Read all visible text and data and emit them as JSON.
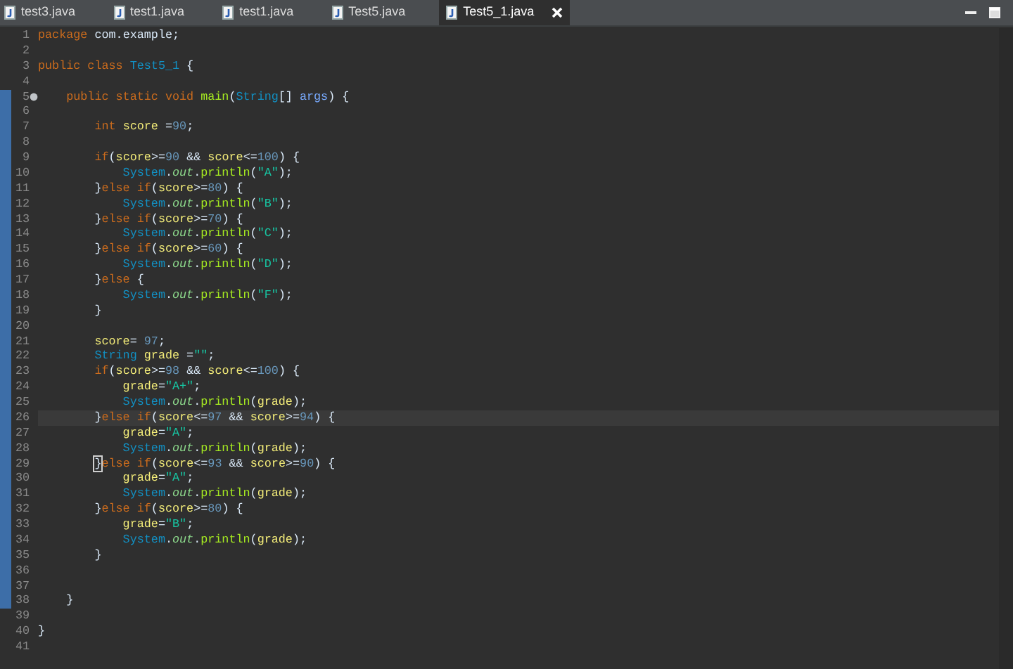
{
  "tabs": [
    {
      "label": "test3.java",
      "selected": false
    },
    {
      "label": "test1.java",
      "selected": false
    },
    {
      "label": "test1.java",
      "selected": false
    },
    {
      "label": "Test5.java",
      "selected": false
    },
    {
      "label": "Test5_1.java",
      "selected": true
    }
  ],
  "editor": {
    "lines": [
      {
        "number": "1",
        "current": false,
        "in_range": false,
        "marker": false,
        "tokens": [
          {
            "text": "package ",
            "kind": "keyword"
          },
          {
            "text": "com.example;",
            "kind": "plain"
          }
        ]
      },
      {
        "number": "2",
        "current": false,
        "in_range": false,
        "marker": false
      },
      {
        "number": "3",
        "current": false,
        "in_range": false,
        "marker": false,
        "tokens": [
          {
            "text": "public class ",
            "kind": "keyword"
          },
          {
            "text": "Test5_1",
            "kind": "type"
          },
          {
            "text": " {",
            "kind": "plain"
          }
        ]
      },
      {
        "number": "4",
        "current": false,
        "in_range": false,
        "marker": false
      },
      {
        "number": "5",
        "current": false,
        "in_range": true,
        "marker": true,
        "tokens": [
          {
            "text": "    public static void ",
            "kind": "keyword"
          },
          {
            "text": "main",
            "kind": "method"
          },
          {
            "text": "(",
            "kind": "plain"
          },
          {
            "text": "String",
            "kind": "type"
          },
          {
            "text": "[] ",
            "kind": "plain"
          },
          {
            "text": "args",
            "kind": "param"
          },
          {
            "text": ") {",
            "kind": "plain"
          }
        ]
      },
      {
        "number": "6",
        "current": false,
        "in_range": true,
        "marker": false
      },
      {
        "number": "7",
        "current": false,
        "in_range": true,
        "marker": false,
        "tokens": [
          {
            "text": "        int ",
            "kind": "keyword"
          },
          {
            "text": "score",
            "kind": "local"
          },
          {
            "text": " =",
            "kind": "plain"
          },
          {
            "text": "90",
            "kind": "number"
          },
          {
            "text": ";",
            "kind": "plain"
          }
        ]
      },
      {
        "number": "8",
        "current": false,
        "in_range": true,
        "marker": false
      },
      {
        "number": "9",
        "current": false,
        "in_range": true,
        "marker": false,
        "tokens": [
          {
            "text": "        if",
            "kind": "keyword"
          },
          {
            "text": "(",
            "kind": "plain"
          },
          {
            "text": "score",
            "kind": "local"
          },
          {
            "text": ">=",
            "kind": "plain"
          },
          {
            "text": "90",
            "kind": "number"
          },
          {
            "text": " && ",
            "kind": "plain"
          },
          {
            "text": "score",
            "kind": "local"
          },
          {
            "text": "<=",
            "kind": "plain"
          },
          {
            "text": "100",
            "kind": "number"
          },
          {
            "text": ") {",
            "kind": "plain"
          }
        ]
      },
      {
        "number": "10",
        "current": false,
        "in_range": true,
        "marker": false,
        "tokens": [
          {
            "text": "            System",
            "kind": "type"
          },
          {
            "text": ".",
            "kind": "plain"
          },
          {
            "text": "out",
            "kind": "field"
          },
          {
            "text": ".",
            "kind": "plain"
          },
          {
            "text": "println",
            "kind": "method"
          },
          {
            "text": "(",
            "kind": "plain"
          },
          {
            "text": "\"A\"",
            "kind": "string"
          },
          {
            "text": ");",
            "kind": "plain"
          }
        ]
      },
      {
        "number": "11",
        "current": false,
        "in_range": true,
        "marker": false,
        "tokens": [
          {
            "text": "        }",
            "kind": "plain"
          },
          {
            "text": "else if",
            "kind": "keyword"
          },
          {
            "text": "(",
            "kind": "plain"
          },
          {
            "text": "score",
            "kind": "local"
          },
          {
            "text": ">=",
            "kind": "plain"
          },
          {
            "text": "80",
            "kind": "number"
          },
          {
            "text": ") {",
            "kind": "plain"
          }
        ]
      },
      {
        "number": "12",
        "current": false,
        "in_range": true,
        "marker": false,
        "tokens": [
          {
            "text": "            System",
            "kind": "type"
          },
          {
            "text": ".",
            "kind": "plain"
          },
          {
            "text": "out",
            "kind": "field"
          },
          {
            "text": ".",
            "kind": "plain"
          },
          {
            "text": "println",
            "kind": "method"
          },
          {
            "text": "(",
            "kind": "plain"
          },
          {
            "text": "\"B\"",
            "kind": "string"
          },
          {
            "text": ");",
            "kind": "plain"
          }
        ]
      },
      {
        "number": "13",
        "current": false,
        "in_range": true,
        "marker": false,
        "tokens": [
          {
            "text": "        }",
            "kind": "plain"
          },
          {
            "text": "else if",
            "kind": "keyword"
          },
          {
            "text": "(",
            "kind": "plain"
          },
          {
            "text": "score",
            "kind": "local"
          },
          {
            "text": ">=",
            "kind": "plain"
          },
          {
            "text": "70",
            "kind": "number"
          },
          {
            "text": ") {",
            "kind": "plain"
          }
        ]
      },
      {
        "number": "14",
        "current": false,
        "in_range": true,
        "marker": false,
        "tokens": [
          {
            "text": "            System",
            "kind": "type"
          },
          {
            "text": ".",
            "kind": "plain"
          },
          {
            "text": "out",
            "kind": "field"
          },
          {
            "text": ".",
            "kind": "plain"
          },
          {
            "text": "println",
            "kind": "method"
          },
          {
            "text": "(",
            "kind": "plain"
          },
          {
            "text": "\"C\"",
            "kind": "string"
          },
          {
            "text": ");",
            "kind": "plain"
          }
        ]
      },
      {
        "number": "15",
        "current": false,
        "in_range": true,
        "marker": false,
        "tokens": [
          {
            "text": "        }",
            "kind": "plain"
          },
          {
            "text": "else if",
            "kind": "keyword"
          },
          {
            "text": "(",
            "kind": "plain"
          },
          {
            "text": "score",
            "kind": "local"
          },
          {
            "text": ">=",
            "kind": "plain"
          },
          {
            "text": "60",
            "kind": "number"
          },
          {
            "text": ") {",
            "kind": "plain"
          }
        ]
      },
      {
        "number": "16",
        "current": false,
        "in_range": true,
        "marker": false,
        "tokens": [
          {
            "text": "            System",
            "kind": "type"
          },
          {
            "text": ".",
            "kind": "plain"
          },
          {
            "text": "out",
            "kind": "field"
          },
          {
            "text": ".",
            "kind": "plain"
          },
          {
            "text": "println",
            "kind": "method"
          },
          {
            "text": "(",
            "kind": "plain"
          },
          {
            "text": "\"D\"",
            "kind": "string"
          },
          {
            "text": ");",
            "kind": "plain"
          }
        ]
      },
      {
        "number": "17",
        "current": false,
        "in_range": true,
        "marker": false,
        "tokens": [
          {
            "text": "        }",
            "kind": "plain"
          },
          {
            "text": "else",
            "kind": "keyword"
          },
          {
            "text": " {",
            "kind": "plain"
          }
        ]
      },
      {
        "number": "18",
        "current": false,
        "in_range": true,
        "marker": false,
        "tokens": [
          {
            "text": "            System",
            "kind": "type"
          },
          {
            "text": ".",
            "kind": "plain"
          },
          {
            "text": "out",
            "kind": "field"
          },
          {
            "text": ".",
            "kind": "plain"
          },
          {
            "text": "println",
            "kind": "method"
          },
          {
            "text": "(",
            "kind": "plain"
          },
          {
            "text": "\"F\"",
            "kind": "string"
          },
          {
            "text": ");",
            "kind": "plain"
          }
        ]
      },
      {
        "number": "19",
        "current": false,
        "in_range": true,
        "marker": false,
        "tokens": [
          {
            "text": "        }",
            "kind": "plain"
          }
        ]
      },
      {
        "number": "20",
        "current": false,
        "in_range": true,
        "marker": false
      },
      {
        "number": "21",
        "current": false,
        "in_range": true,
        "marker": false,
        "tokens": [
          {
            "text": "        score",
            "kind": "local"
          },
          {
            "text": "= ",
            "kind": "plain"
          },
          {
            "text": "97",
            "kind": "number"
          },
          {
            "text": ";",
            "kind": "plain"
          }
        ]
      },
      {
        "number": "22",
        "current": false,
        "in_range": true,
        "marker": false,
        "tokens": [
          {
            "text": "        String",
            "kind": "type"
          },
          {
            "text": " grade",
            "kind": "local"
          },
          {
            "text": " =",
            "kind": "plain"
          },
          {
            "text": "\"\"",
            "kind": "string"
          },
          {
            "text": ";",
            "kind": "plain"
          }
        ]
      },
      {
        "number": "23",
        "current": false,
        "in_range": true,
        "marker": false,
        "tokens": [
          {
            "text": "        if",
            "kind": "keyword"
          },
          {
            "text": "(",
            "kind": "plain"
          },
          {
            "text": "score",
            "kind": "local"
          },
          {
            "text": ">=",
            "kind": "plain"
          },
          {
            "text": "98",
            "kind": "number"
          },
          {
            "text": " && ",
            "kind": "plain"
          },
          {
            "text": "score",
            "kind": "local"
          },
          {
            "text": "<=",
            "kind": "plain"
          },
          {
            "text": "100",
            "kind": "number"
          },
          {
            "text": ") {",
            "kind": "plain"
          }
        ]
      },
      {
        "number": "24",
        "current": false,
        "in_range": true,
        "marker": false,
        "tokens": [
          {
            "text": "            grade",
            "kind": "local"
          },
          {
            "text": "=",
            "kind": "plain"
          },
          {
            "text": "\"A+\"",
            "kind": "string"
          },
          {
            "text": ";",
            "kind": "plain"
          }
        ]
      },
      {
        "number": "25",
        "current": false,
        "in_range": true,
        "marker": false,
        "tokens": [
          {
            "text": "            System",
            "kind": "type"
          },
          {
            "text": ".",
            "kind": "plain"
          },
          {
            "text": "out",
            "kind": "field"
          },
          {
            "text": ".",
            "kind": "plain"
          },
          {
            "text": "println",
            "kind": "method"
          },
          {
            "text": "(",
            "kind": "plain"
          },
          {
            "text": "grade",
            "kind": "local"
          },
          {
            "text": ");",
            "kind": "plain"
          }
        ]
      },
      {
        "number": "26",
        "current": true,
        "in_range": true,
        "marker": false,
        "tokens": [
          {
            "text": "        }",
            "kind": "plain"
          },
          {
            "text": "else if",
            "kind": "keyword"
          },
          {
            "text": "(",
            "kind": "plain"
          },
          {
            "text": "score",
            "kind": "local"
          },
          {
            "text": "<=",
            "kind": "plain"
          },
          {
            "text": "97",
            "kind": "number"
          },
          {
            "text": " && ",
            "kind": "plain"
          },
          {
            "text": "score",
            "kind": "local"
          },
          {
            "text": ">=",
            "kind": "plain"
          },
          {
            "text": "94",
            "kind": "number"
          },
          {
            "text": ") {",
            "kind": "plain"
          }
        ]
      },
      {
        "number": "27",
        "current": false,
        "in_range": true,
        "marker": false,
        "tokens": [
          {
            "text": "            grade",
            "kind": "local"
          },
          {
            "text": "=",
            "kind": "plain"
          },
          {
            "text": "\"A\"",
            "kind": "string"
          },
          {
            "text": ";",
            "kind": "plain"
          }
        ]
      },
      {
        "number": "28",
        "current": false,
        "in_range": true,
        "marker": false,
        "tokens": [
          {
            "text": "            System",
            "kind": "type"
          },
          {
            "text": ".",
            "kind": "plain"
          },
          {
            "text": "out",
            "kind": "field"
          },
          {
            "text": ".",
            "kind": "plain"
          },
          {
            "text": "println",
            "kind": "method"
          },
          {
            "text": "(",
            "kind": "plain"
          },
          {
            "text": "grade",
            "kind": "local"
          },
          {
            "text": ");",
            "kind": "plain"
          }
        ]
      },
      {
        "number": "29",
        "current": false,
        "in_range": true,
        "marker": false,
        "tokens": [
          {
            "text": "        }",
            "kind": "matched_bracket"
          },
          {
            "text": "else if",
            "kind": "keyword"
          },
          {
            "text": "(",
            "kind": "plain"
          },
          {
            "text": "score",
            "kind": "local"
          },
          {
            "text": "<=",
            "kind": "plain"
          },
          {
            "text": "93",
            "kind": "number"
          },
          {
            "text": " && ",
            "kind": "plain"
          },
          {
            "text": "score",
            "kind": "local"
          },
          {
            "text": ">=",
            "kind": "plain"
          },
          {
            "text": "90",
            "kind": "number"
          },
          {
            "text": ") {",
            "kind": "plain"
          }
        ]
      },
      {
        "number": "30",
        "current": false,
        "in_range": true,
        "marker": false,
        "tokens": [
          {
            "text": "            grade",
            "kind": "local"
          },
          {
            "text": "=",
            "kind": "plain"
          },
          {
            "text": "\"A\"",
            "kind": "string"
          },
          {
            "text": ";",
            "kind": "plain"
          }
        ]
      },
      {
        "number": "31",
        "current": false,
        "in_range": true,
        "marker": false,
        "tokens": [
          {
            "text": "            System",
            "kind": "type"
          },
          {
            "text": ".",
            "kind": "plain"
          },
          {
            "text": "out",
            "kind": "field"
          },
          {
            "text": ".",
            "kind": "plain"
          },
          {
            "text": "println",
            "kind": "method"
          },
          {
            "text": "(",
            "kind": "plain"
          },
          {
            "text": "grade",
            "kind": "local"
          },
          {
            "text": ");",
            "kind": "plain"
          }
        ]
      },
      {
        "number": "32",
        "current": false,
        "in_range": true,
        "marker": false,
        "tokens": [
          {
            "text": "        }",
            "kind": "plain"
          },
          {
            "text": "else if",
            "kind": "keyword"
          },
          {
            "text": "(",
            "kind": "plain"
          },
          {
            "text": "score",
            "kind": "local"
          },
          {
            "text": ">=",
            "kind": "plain"
          },
          {
            "text": "80",
            "kind": "number"
          },
          {
            "text": ") {",
            "kind": "plain"
          }
        ]
      },
      {
        "number": "33",
        "current": false,
        "in_range": true,
        "marker": false,
        "tokens": [
          {
            "text": "            grade",
            "kind": "local"
          },
          {
            "text": "=",
            "kind": "plain"
          },
          {
            "text": "\"B\"",
            "kind": "string"
          },
          {
            "text": ";",
            "kind": "plain"
          }
        ]
      },
      {
        "number": "34",
        "current": false,
        "in_range": true,
        "marker": false,
        "tokens": [
          {
            "text": "            System",
            "kind": "type"
          },
          {
            "text": ".",
            "kind": "plain"
          },
          {
            "text": "out",
            "kind": "field"
          },
          {
            "text": ".",
            "kind": "plain"
          },
          {
            "text": "println",
            "kind": "method"
          },
          {
            "text": "(",
            "kind": "plain"
          },
          {
            "text": "grade",
            "kind": "local"
          },
          {
            "text": ");",
            "kind": "plain"
          }
        ]
      },
      {
        "number": "35",
        "current": false,
        "in_range": true,
        "marker": false,
        "tokens": [
          {
            "text": "        }",
            "kind": "plain"
          }
        ]
      },
      {
        "number": "36",
        "current": false,
        "in_range": true,
        "marker": false
      },
      {
        "number": "37",
        "current": false,
        "in_range": true,
        "marker": false
      },
      {
        "number": "38",
        "current": false,
        "in_range": true,
        "marker": false,
        "tokens": [
          {
            "text": "    }",
            "kind": "plain"
          }
        ]
      },
      {
        "number": "39",
        "current": false,
        "in_range": false,
        "marker": false
      },
      {
        "number": "40",
        "current": false,
        "in_range": false,
        "marker": false,
        "tokens": [
          {
            "text": "}",
            "kind": "plain"
          }
        ]
      },
      {
        "number": "41",
        "current": false,
        "in_range": false,
        "marker": false
      }
    ]
  }
}
